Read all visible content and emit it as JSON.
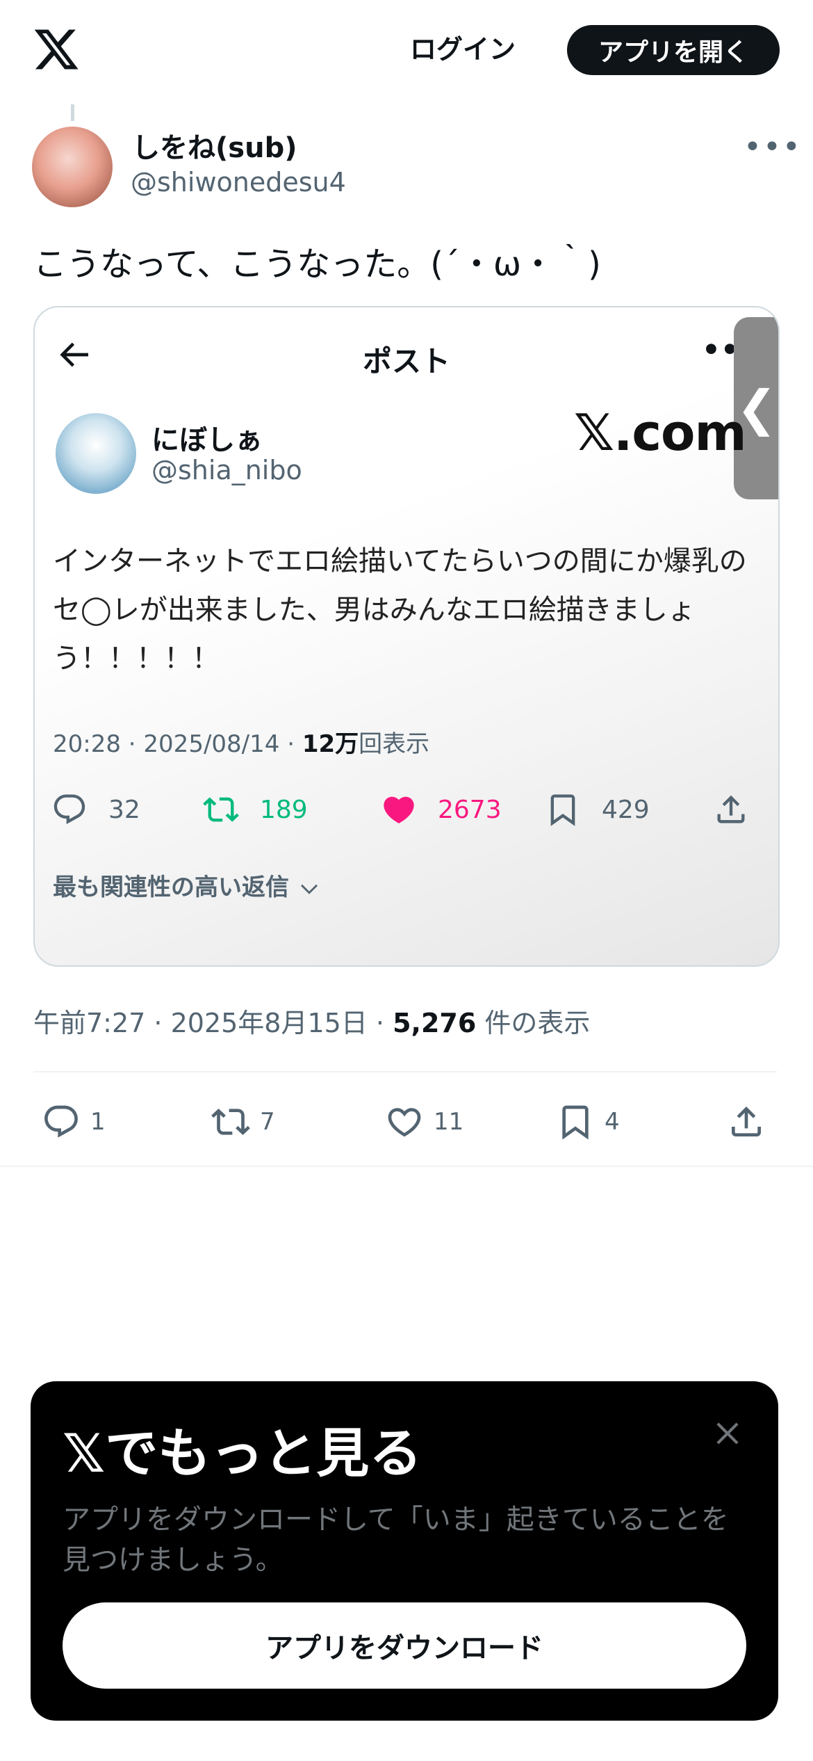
{
  "header": {
    "login_label": "ログイン",
    "open_app_label": "アプリを開く"
  },
  "tweet": {
    "display_name": "しをね(sub)",
    "handle": "@shiwonedesu4",
    "more_label": "•••",
    "text": "こうなって、こうなった。(´・ω・｀)",
    "meta": {
      "time": "午前7:27",
      "date": "2025年8月15日",
      "views_count": "5,276",
      "views_label": "件の表示"
    },
    "stats": {
      "replies": "1",
      "reposts": "7",
      "likes": "11",
      "bookmarks": "4"
    }
  },
  "embedded_screenshot": {
    "title": "ポスト",
    "more_label": "••",
    "side_tab_glyph": "❮",
    "display_name": "にぼしぁ",
    "handle": "@shia_nibo",
    "watermark": "𝕏.com",
    "text": "インターネットでエロ絵描いてたらいつの間にか爆乳のセ◯レが出来ました、男はみんなエロ絵描きましょう！！！！！",
    "meta": {
      "time": "20:28",
      "date": "2025/08/14",
      "views_count": "12万",
      "views_label": "回表示"
    },
    "stats": {
      "replies": "32",
      "reposts": "189",
      "likes": "2673",
      "bookmarks": "429"
    },
    "relevant_replies": "最も関連性の高い返信"
  },
  "promo": {
    "title": "𝕏でもっと見る",
    "description": "アプリをダウンロードして「いま」起きていることを見つけましょう。",
    "button_label": "アプリをダウンロード"
  },
  "colors": {
    "repost_green": "#00ba7c",
    "like_pink": "#f91880",
    "secondary_text": "#536471"
  }
}
